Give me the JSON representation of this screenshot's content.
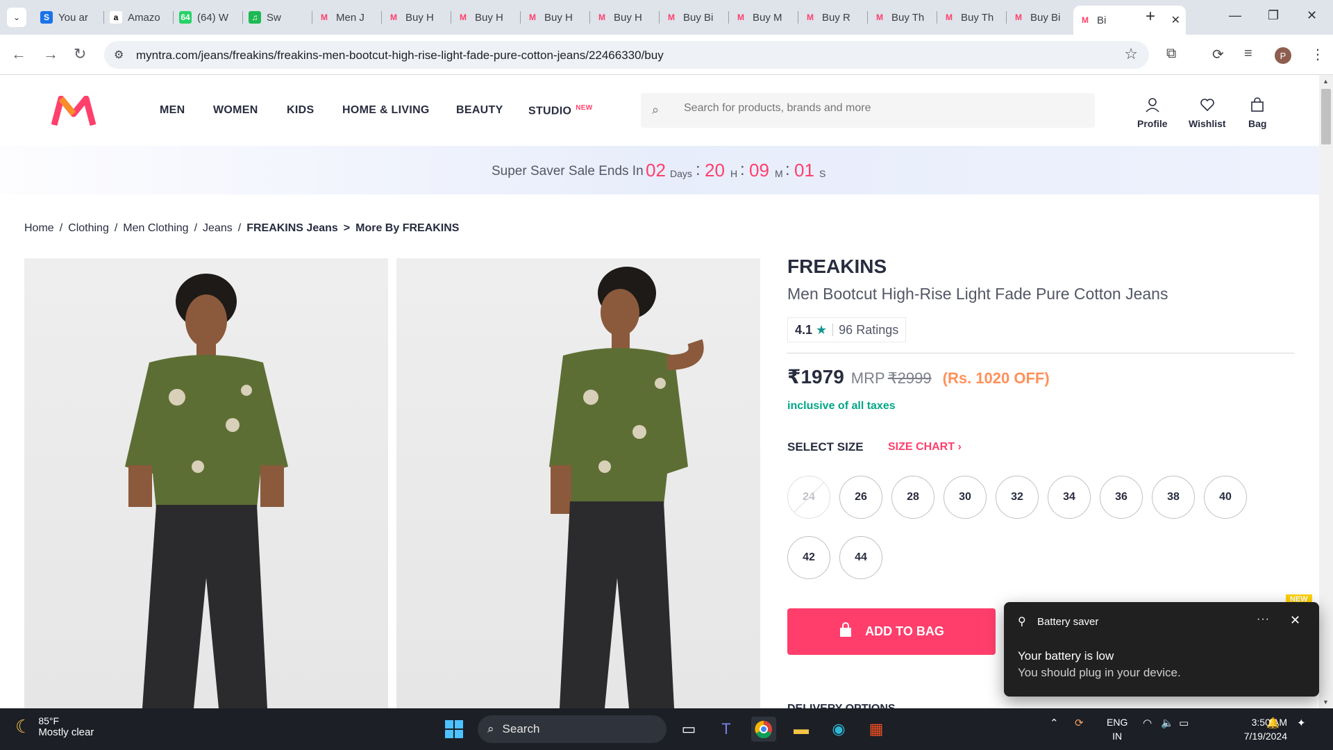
{
  "browser": {
    "tabs": [
      {
        "label": "You ar",
        "fav_color": "#1a73e8",
        "fav_char": "S"
      },
      {
        "label": "Amazo",
        "fav_color": "#fff",
        "fav_char": "a"
      },
      {
        "label": "(64) W",
        "fav_color": "#25d366",
        "fav_char": "64"
      },
      {
        "label": "Sw",
        "fav_color": "#1db954",
        "fav_char": "♫"
      },
      {
        "label": "Men J",
        "fav_color": "#ff3f6c",
        "fav_char": "M"
      },
      {
        "label": "Buy H",
        "fav_color": "#ff3f6c",
        "fav_char": "M"
      },
      {
        "label": "Buy H",
        "fav_color": "#ff3f6c",
        "fav_char": "M"
      },
      {
        "label": "Buy H",
        "fav_color": "#ff3f6c",
        "fav_char": "M"
      },
      {
        "label": "Buy H",
        "fav_color": "#ff3f6c",
        "fav_char": "M"
      },
      {
        "label": "Buy Bi",
        "fav_color": "#ff3f6c",
        "fav_char": "M"
      },
      {
        "label": "Buy M",
        "fav_color": "#ff3f6c",
        "fav_char": "M"
      },
      {
        "label": "Buy R",
        "fav_color": "#ff3f6c",
        "fav_char": "M"
      },
      {
        "label": "Buy Th",
        "fav_color": "#ff3f6c",
        "fav_char": "M"
      },
      {
        "label": "Buy Th",
        "fav_color": "#ff3f6c",
        "fav_char": "M"
      },
      {
        "label": "Buy Bi",
        "fav_color": "#ff3f6c",
        "fav_char": "M"
      }
    ],
    "active_tab": {
      "label": "Bi",
      "close": "✕"
    },
    "new_tab": "+",
    "url": "myntra.com/jeans/freakins/freakins-men-bootcut-high-rise-light-fade-pure-cotton-jeans/22466330/buy",
    "profile_initial": "P"
  },
  "header": {
    "nav": [
      "MEN",
      "WOMEN",
      "KIDS",
      "HOME & LIVING",
      "BEAUTY",
      "STUDIO"
    ],
    "studio_badge": "NEW",
    "search_placeholder": "Search for products, brands and more",
    "actions": {
      "profile": "Profile",
      "wishlist": "Wishlist",
      "bag": "Bag"
    },
    "brand_color": "#ff3f6c"
  },
  "sale": {
    "text": "Super Saver Sale Ends In",
    "days": "02",
    "days_unit": "Days",
    "hours": "20",
    "hours_unit": "H",
    "minutes": "09",
    "minutes_unit": "M",
    "seconds": "01",
    "seconds_unit": "S"
  },
  "breadcrumb": {
    "items": [
      "Home",
      "Clothing",
      "Men Clothing",
      "Jeans"
    ],
    "brand_link": "FREAKINS Jeans",
    "more_link": "More By FREAKINS",
    "sep": "/",
    "arrow": ">"
  },
  "product": {
    "brand": "FREAKINS",
    "name": "Men Bootcut High-Rise Light Fade Pure Cotton Jeans",
    "rating": "4.1",
    "rating_count": "96 Ratings",
    "price": "₹1979",
    "mrp_label": "MRP",
    "mrp": "₹2999",
    "discount": "(Rs. 1020 OFF)",
    "taxes": "inclusive of all taxes",
    "select_size": "SELECT SIZE",
    "size_chart": "SIZE CHART",
    "sizes": [
      "24",
      "26",
      "28",
      "30",
      "32",
      "34",
      "36",
      "38",
      "40",
      "42",
      "44"
    ],
    "unavailable": [
      "24"
    ],
    "add_to_bag": "ADD TO BAG",
    "delivery": "DELIVERY OPTIONS"
  },
  "toast": {
    "title": "Battery saver",
    "more": "···",
    "close": "✕",
    "heading": "Your battery is low",
    "body": "You should plug in your device.",
    "badge": "NEW"
  },
  "taskbar": {
    "temp": "85°F",
    "weather": "Mostly clear",
    "search": "Search",
    "lang1": "ENG",
    "lang2": "IN",
    "time": "3:50 AM",
    "date": "7/19/2024"
  }
}
